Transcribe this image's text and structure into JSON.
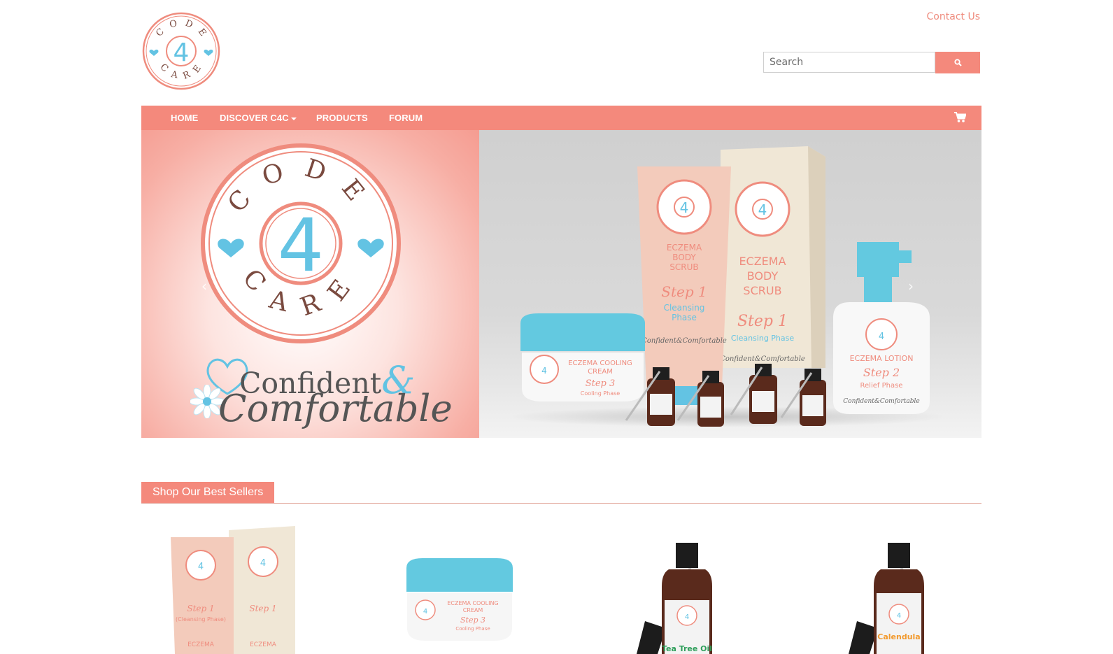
{
  "header": {
    "logo": {
      "letters_top": "CODE",
      "number": "4",
      "letters_bottom": "CARE",
      "icon": "code4care-logo-icon"
    },
    "contact_label": "Contact Us",
    "search": {
      "placeholder": "Search",
      "value": "",
      "button_icon": "search-icon"
    }
  },
  "nav": {
    "items": [
      {
        "label": "HOME",
        "has_dropdown": false
      },
      {
        "label": "DISCOVER C4C",
        "has_dropdown": true
      },
      {
        "label": "PRODUCTS",
        "has_dropdown": false
      },
      {
        "label": "FORUM",
        "has_dropdown": false
      }
    ],
    "cart_icon": "shopping-cart-icon"
  },
  "hero": {
    "logo": {
      "letters_top": "CODE",
      "number": "4",
      "letters_bottom": "CARE"
    },
    "tagline_word1": "Confident",
    "tagline_amp": "&",
    "tagline_word2": "Comfortable",
    "prev_icon": "chevron-left-icon",
    "next_icon": "chevron-right-icon",
    "products": {
      "tube": {
        "name_lines": [
          "ECZEMA",
          "BODY",
          "SCRUB"
        ],
        "step": "Step 1",
        "phase_lines": [
          "Cleansing",
          "Phase"
        ]
      },
      "box": {
        "name_lines": [
          "ECZEMA",
          "BODY",
          "SCRUB"
        ],
        "step": "Step 1",
        "phase": "Cleansing Phase"
      },
      "jar": {
        "name_lines": [
          "ECZEMA COOLING",
          "CREAM"
        ],
        "step": "Step 3",
        "phase": "Cooling Phase"
      },
      "pump": {
        "name": "ECZEMA LOTION",
        "step": "Step 2",
        "phase": "Relief Phase"
      },
      "brand_small": "Confident&Comfortable"
    }
  },
  "best_sellers": {
    "title": "Shop Our Best Sellers",
    "items": [
      {
        "kind": "scrub-set",
        "labels": [
          "Step 1",
          "(Cleansing Phase)",
          "ECZEMA"
        ]
      },
      {
        "kind": "cooling-cream",
        "labels": [
          "ECZEMA COOLING",
          "CREAM",
          "Step 3",
          "Cooling Phase"
        ]
      },
      {
        "kind": "oil-bottle",
        "labels": [
          "Tea Tree Oil"
        ],
        "accent": "#2e9e5a"
      },
      {
        "kind": "oil-bottle",
        "labels": [
          "Calendula"
        ],
        "accent": "#f29a2e"
      }
    ]
  },
  "colors": {
    "accent": "#f4897c",
    "logo_ring": "#ef8c7e",
    "logo_blue": "#63c3e3",
    "logo_brown": "#7a4a3f"
  }
}
